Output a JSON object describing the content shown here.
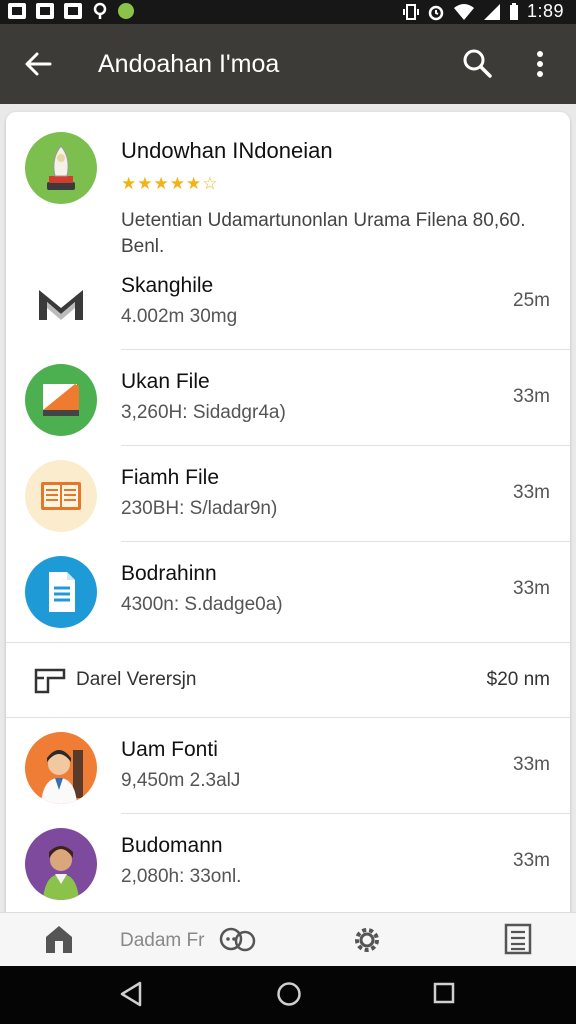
{
  "status_bar": {
    "time": "1:89"
  },
  "app_bar": {
    "title": "Andoahan I'moa"
  },
  "featured": {
    "name": "Undowhan INdoneian",
    "stars": "★★★★★☆",
    "description": "Uetentian Udamartunonlan Urama Filenа 80,60. Benl."
  },
  "items": [
    {
      "name": "Skanghile",
      "sub": "4.002m 30mg",
      "time": "25m"
    },
    {
      "name": "Ukan File",
      "sub": "3,260H: Sidadgr4a)",
      "time": "33m"
    },
    {
      "name": "Fiamh File",
      "sub": "230BH: S/ladar9n)",
      "time": "33m"
    },
    {
      "name": "Bodrahinn",
      "sub": "4300n: S.dadge0a)",
      "time": "33m"
    }
  ],
  "section": {
    "label": "Darel Verersjn",
    "value": "$20 nm"
  },
  "items2": [
    {
      "name": "Uam Fonti",
      "sub": "9,450m 2.3alJ",
      "time": "33m"
    },
    {
      "name": "Budomann",
      "sub": "2,080h: 33onl.",
      "time": "33m"
    }
  ],
  "bottom_nav": {
    "label": "Dadam Fr"
  },
  "colors": {
    "app_bar": "#3d3b37",
    "green": "#5cb85c",
    "blue": "#1e9bd7",
    "orange": "#f07d35",
    "purple": "#7e4a9e",
    "star": "#f3b215"
  }
}
